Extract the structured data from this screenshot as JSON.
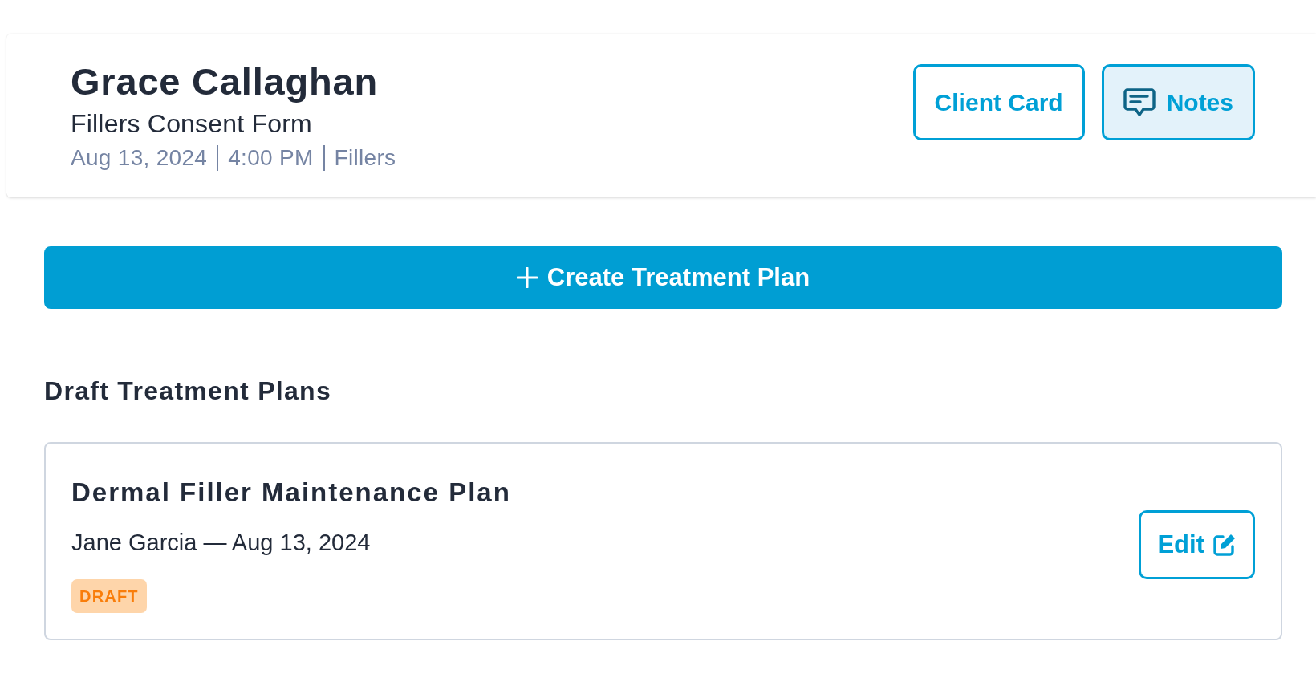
{
  "header": {
    "client_name": "Grace Callaghan",
    "form_title": "Fillers Consent Form",
    "meta": [
      "Aug 13, 2024",
      "4:00 PM",
      "Fillers"
    ],
    "buttons": [
      {
        "label": "Client Card",
        "kind": "text",
        "active": false
      },
      {
        "label": "Notes",
        "kind": "notes",
        "active": true
      }
    ]
  },
  "create_button": {
    "label": "Create Treatment Plan"
  },
  "drafts": {
    "title": "Draft Treatment Plans",
    "plans": [
      {
        "title": "Dermal Filler Maintenance Plan",
        "subtitle": "Jane Garcia — Aug 13, 2024",
        "status": {
          "label": "DRAFT",
          "kind": "draft"
        },
        "edit_label": "Edit"
      }
    ]
  }
}
